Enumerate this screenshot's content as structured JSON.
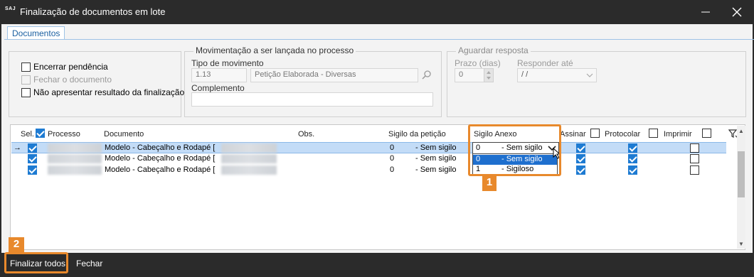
{
  "window": {
    "logo": "SAJ",
    "title": "Finalização de documentos em lote",
    "minimize": "—",
    "close": "✕"
  },
  "tabs": [
    "Documentos"
  ],
  "options": {
    "encerrar": "Encerrar pendência",
    "fechar_doc": "Fechar o documento",
    "nao_apresentar": "Não apresentar resultado da finalização"
  },
  "movimentacao": {
    "legend": "Movimentação a ser lançada no processo",
    "tipo_label": "Tipo de movimento",
    "tipo_code": "1.13",
    "tipo_desc": "Petição Elaborada - Diversas",
    "complemento_label": "Complemento",
    "complemento_value": ""
  },
  "aguardar": {
    "legend": "Aguardar resposta",
    "prazo_label": "Prazo (dias)",
    "prazo_value": "0",
    "responder_label": "Responder até",
    "responder_value": " /  /"
  },
  "grid": {
    "headers": {
      "sel": "Sel.",
      "processo": "Processo",
      "documento": "Documento",
      "obs": "Obs.",
      "sigilo_peticao": "Sigilo da petição",
      "sigilo_anexo": "Sigilo Anexo",
      "assinar": "Assinar",
      "protocolar": "Protocolar",
      "imprimir": "Imprimir"
    },
    "rows": [
      {
        "documento": "Modelo - Cabeçalho e Rodapé [",
        "sig_code": "0",
        "sig_text": "- Sem sigilo",
        "anexo_code": "0",
        "anexo_text": "- Sem sigilo"
      },
      {
        "documento": "Modelo - Cabeçalho e Rodapé [",
        "sig_code": "0",
        "sig_text": "- Sem sigilo",
        "anexo_code": "",
        "anexo_text": ""
      },
      {
        "documento": "Modelo - Cabeçalho e Rodapé [",
        "sig_code": "0",
        "sig_text": "- Sem sigilo",
        "anexo_code": "",
        "anexo_text": ""
      }
    ],
    "row_pointer": "→",
    "filter_icon": "filter"
  },
  "dropdown_options": [
    {
      "code": "0",
      "label": "- Sem sigilo"
    },
    {
      "code": "1",
      "label": "- Sigiloso"
    }
  ],
  "callouts": [
    "1",
    "2"
  ],
  "buttons": {
    "finalizar": "Finalizar todos",
    "fechar": "Fechar"
  },
  "colors": {
    "accent": "#e8892c",
    "selection": "#c3dcf7",
    "check": "#1e7bd2",
    "titlebar": "#2b2b2b"
  }
}
